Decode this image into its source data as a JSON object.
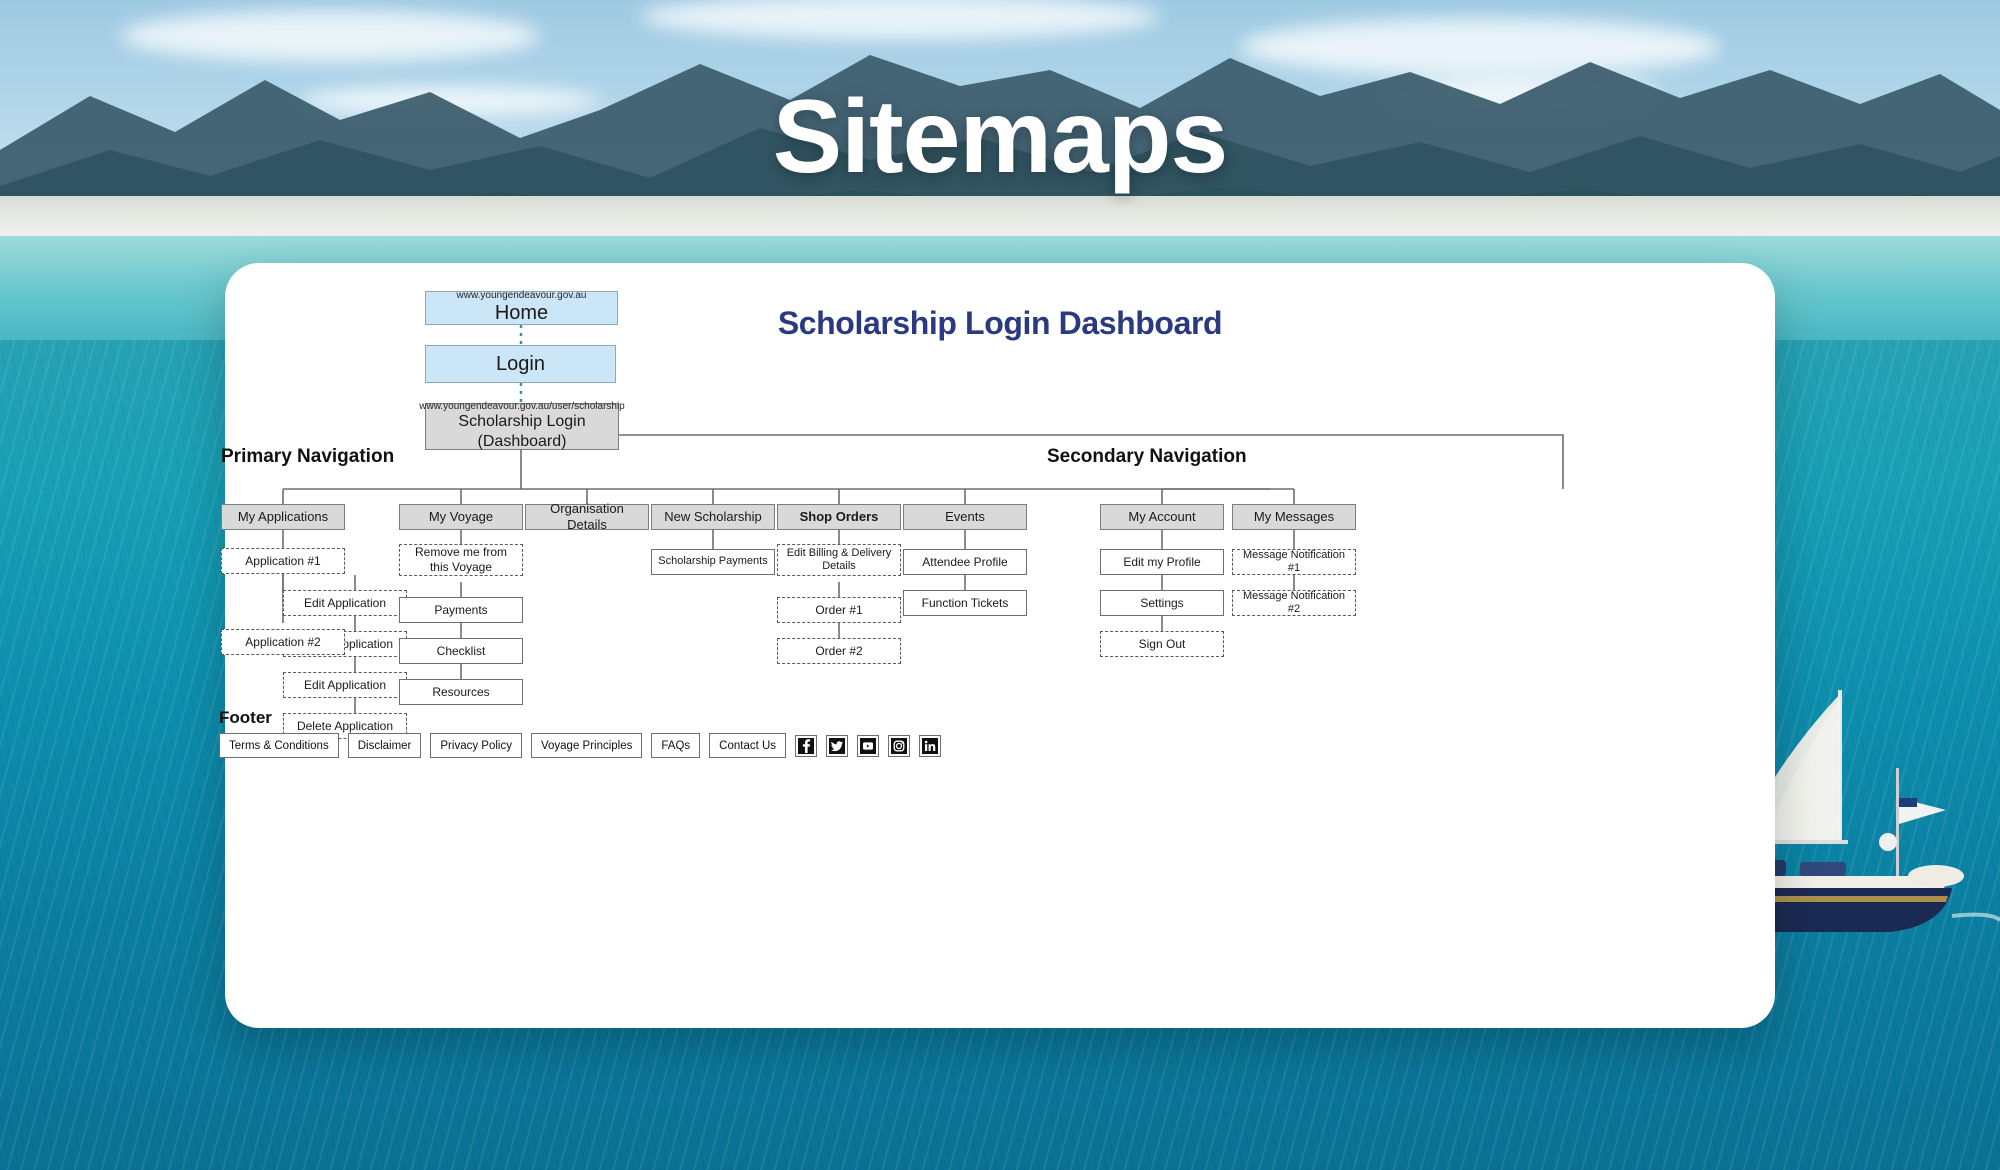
{
  "hero": {
    "title": "Sitemaps"
  },
  "card": {
    "title": "Scholarship Login Dashboard"
  },
  "colors": {
    "accent_title": "#2b3a80",
    "node_blue": "#cbe6f7",
    "node_grey": "#d9d9d9",
    "connector_teal": "#2f9aa6",
    "connector_grey": "#6e6e6e"
  },
  "top_flow": {
    "home": {
      "url": "www.youngendeavour.gov.au",
      "label": "Home"
    },
    "login": {
      "label": "Login"
    },
    "dashboard": {
      "url": "www.youngendeavour.gov.au/user/scholarship",
      "label_line1": "Scholarship Login",
      "label_line2": "(Dashboard)"
    }
  },
  "sections": {
    "primary": "Primary Navigation",
    "secondary": "Secondary Navigation"
  },
  "primary_nav": [
    {
      "label": "My Applications",
      "children": [
        {
          "label": "Application #1",
          "style": "dash"
        },
        {
          "label": "Edit Application",
          "style": "dash"
        },
        {
          "label": "Delete Application",
          "style": "dash"
        },
        {
          "label": "Application #2",
          "style": "dash"
        },
        {
          "label": "Edit Application",
          "style": "dash"
        },
        {
          "label": "Delete Application",
          "style": "dash"
        }
      ]
    },
    {
      "label": "My Voyage",
      "children": [
        {
          "label": "Remove me from this Voyage",
          "style": "dash"
        },
        {
          "label": "Payments",
          "style": "white"
        },
        {
          "label": "Checklist",
          "style": "white"
        },
        {
          "label": "Resources",
          "style": "white"
        }
      ]
    },
    {
      "label": "Organisation Details",
      "children": []
    },
    {
      "label": "New Scholarship",
      "children": [
        {
          "label": "Scholarship Payments",
          "style": "white"
        }
      ]
    },
    {
      "label": "Shop Orders",
      "children": [
        {
          "label": "Edit Billing & Delivery Details",
          "style": "dash"
        },
        {
          "label": "Order #1",
          "style": "dash"
        },
        {
          "label": "Order #2",
          "style": "dash"
        }
      ]
    },
    {
      "label": "Events",
      "children": [
        {
          "label": "Attendee Profile",
          "style": "white"
        },
        {
          "label": "Function Tickets",
          "style": "white"
        }
      ]
    }
  ],
  "secondary_nav": [
    {
      "label": "My Account",
      "children": [
        {
          "label": "Edit my Profile",
          "style": "white"
        },
        {
          "label": "Settings",
          "style": "white"
        },
        {
          "label": "Sign Out",
          "style": "dash"
        }
      ]
    },
    {
      "label": "My Messages",
      "children": [
        {
          "label": "Message Notification #1",
          "style": "dash"
        },
        {
          "label": "Message Notification #2",
          "style": "dash"
        }
      ]
    }
  ],
  "footer": {
    "heading": "Footer",
    "links": [
      "Terms & Conditions",
      "Disclaimer",
      "Privacy Policy",
      "Voyage Principles",
      "FAQs",
      "Contact Us"
    ],
    "social": [
      {
        "name": "facebook-icon"
      },
      {
        "name": "twitter-icon"
      },
      {
        "name": "youtube-icon"
      },
      {
        "name": "instagram-icon"
      },
      {
        "name": "linkedin-icon"
      }
    ]
  }
}
